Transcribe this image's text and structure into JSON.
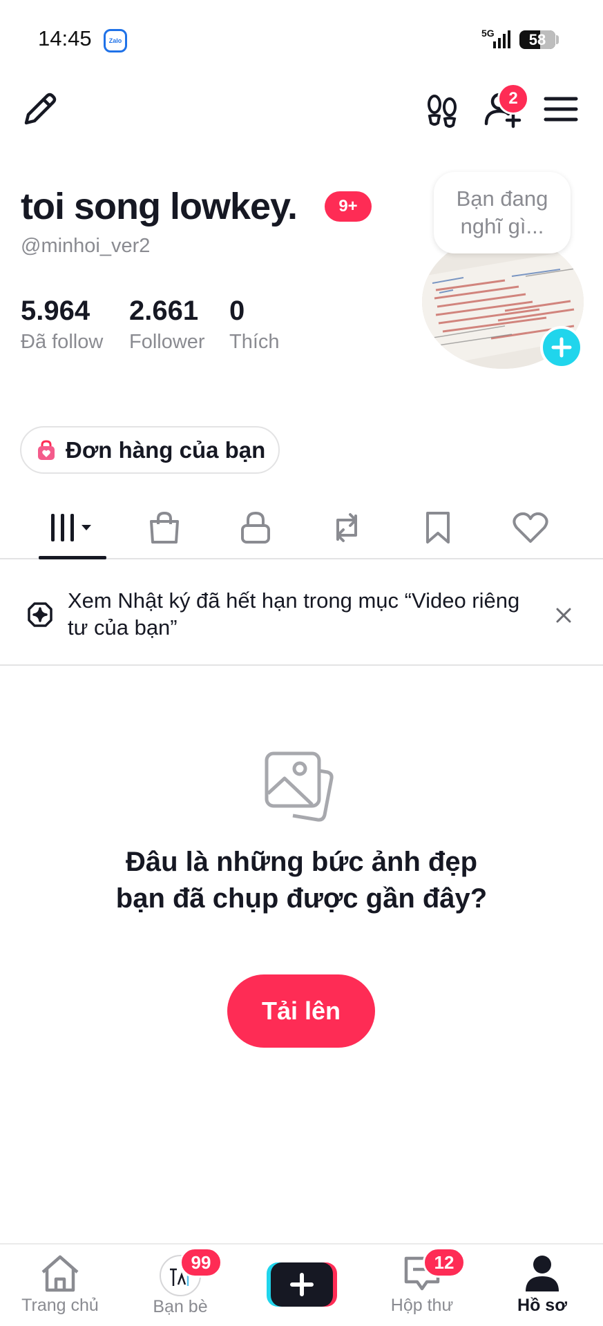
{
  "status_bar": {
    "time": "14:45",
    "app_icon_label": "Zalo",
    "network": "5G",
    "battery": "58",
    "battery_percent": 58
  },
  "top_bar": {
    "friend_requests_badge": "2"
  },
  "profile": {
    "display_name": "toi song lowkey.",
    "name_badge": "9+",
    "username": "@minhoi_ver2",
    "thought_bubble": "Bạn đang nghĩ gì...",
    "stats": [
      {
        "value": "5.964",
        "label": "Đã follow"
      },
      {
        "value": "2.661",
        "label": "Follower"
      },
      {
        "value": "0",
        "label": "Thích"
      }
    ],
    "orders_button": "Đơn hàng của bạn"
  },
  "tabs": [
    {
      "icon": "grid-icon",
      "active": true
    },
    {
      "icon": "shopping-bag-icon"
    },
    {
      "icon": "lock-icon"
    },
    {
      "icon": "repost-icon"
    },
    {
      "icon": "bookmark-icon"
    },
    {
      "icon": "heart-icon"
    }
  ],
  "notice": {
    "text": "Xem Nhật ký đã hết hạn trong mục “Video riêng tư của bạn”"
  },
  "empty_state": {
    "title": "Đâu là những bức ảnh đẹp bạn đã chụp được gần đây?",
    "upload_button": "Tải lên"
  },
  "bottom_nav": {
    "items": [
      {
        "label": "Trang chủ",
        "icon": "home-icon"
      },
      {
        "label": "Bạn bè",
        "icon": "friends-icon",
        "badge": "99"
      },
      {
        "label": "",
        "icon": "plus-icon"
      },
      {
        "label": "Hộp thư",
        "icon": "inbox-icon",
        "badge": "12"
      },
      {
        "label": "Hồ sơ",
        "icon": "profile-icon",
        "active": true
      }
    ]
  },
  "colors": {
    "accent": "#fe2c55",
    "cyan": "#20d5ec",
    "text_primary": "#161823",
    "text_secondary": "#8a8b91"
  }
}
